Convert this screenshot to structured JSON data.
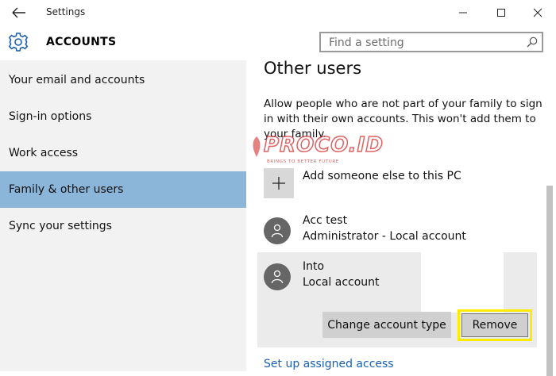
{
  "window": {
    "title": "Settings",
    "controls": [
      "minimize-icon",
      "maximize-icon",
      "close-icon"
    ]
  },
  "header": {
    "section_title": "ACCOUNTS",
    "search_placeholder": "Find a setting"
  },
  "sidebar": {
    "items": [
      {
        "label": "Your email and accounts",
        "active": false
      },
      {
        "label": "Sign-in options",
        "active": false
      },
      {
        "label": "Work access",
        "active": false
      },
      {
        "label": "Family & other users",
        "active": true
      },
      {
        "label": "Sync your settings",
        "active": false
      }
    ]
  },
  "main": {
    "heading": "Other users",
    "description_lines": [
      "Allow people who are not part of your family to sign",
      "in with their own accounts. This won't add them to",
      "your family."
    ],
    "add_label": "Add someone else to this PC",
    "users": [
      {
        "name": "Acc test",
        "type": "Administrator - Local account"
      },
      {
        "name": "Into",
        "type": "Local account"
      }
    ],
    "change_account_type_label": "Change account type",
    "remove_label": "Remove",
    "link_label": "Set up assigned access"
  },
  "watermark": {
    "text": "PROCO.ID",
    "tagline": "BRINGS TO BETTER FUTURE"
  },
  "colors": {
    "accent_active": "#8bb6da",
    "highlight": "#ffeb00",
    "link": "#1a5fb4",
    "gear": "#1a5fb4"
  }
}
